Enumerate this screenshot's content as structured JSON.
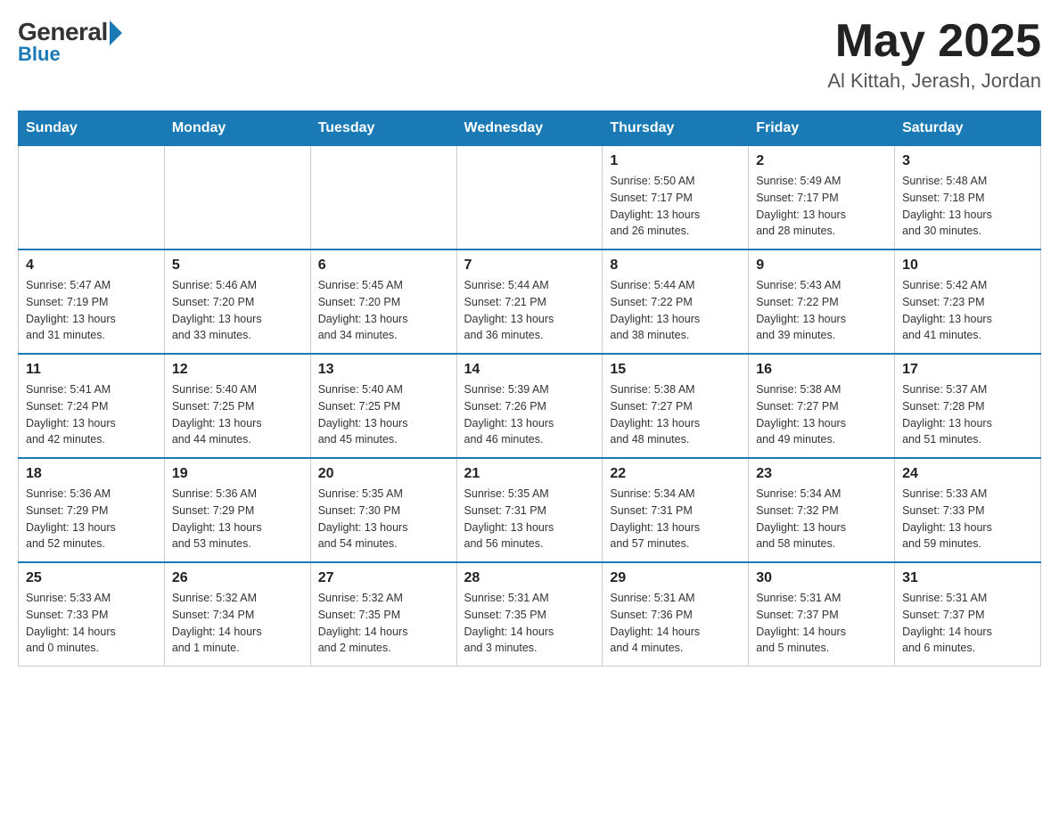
{
  "header": {
    "logo_general": "General",
    "logo_blue": "Blue",
    "month_year": "May 2025",
    "location": "Al Kittah, Jerash, Jordan"
  },
  "weekdays": [
    "Sunday",
    "Monday",
    "Tuesday",
    "Wednesday",
    "Thursday",
    "Friday",
    "Saturday"
  ],
  "weeks": [
    [
      {
        "day": "",
        "info": ""
      },
      {
        "day": "",
        "info": ""
      },
      {
        "day": "",
        "info": ""
      },
      {
        "day": "",
        "info": ""
      },
      {
        "day": "1",
        "info": "Sunrise: 5:50 AM\nSunset: 7:17 PM\nDaylight: 13 hours\nand 26 minutes."
      },
      {
        "day": "2",
        "info": "Sunrise: 5:49 AM\nSunset: 7:17 PM\nDaylight: 13 hours\nand 28 minutes."
      },
      {
        "day": "3",
        "info": "Sunrise: 5:48 AM\nSunset: 7:18 PM\nDaylight: 13 hours\nand 30 minutes."
      }
    ],
    [
      {
        "day": "4",
        "info": "Sunrise: 5:47 AM\nSunset: 7:19 PM\nDaylight: 13 hours\nand 31 minutes."
      },
      {
        "day": "5",
        "info": "Sunrise: 5:46 AM\nSunset: 7:20 PM\nDaylight: 13 hours\nand 33 minutes."
      },
      {
        "day": "6",
        "info": "Sunrise: 5:45 AM\nSunset: 7:20 PM\nDaylight: 13 hours\nand 34 minutes."
      },
      {
        "day": "7",
        "info": "Sunrise: 5:44 AM\nSunset: 7:21 PM\nDaylight: 13 hours\nand 36 minutes."
      },
      {
        "day": "8",
        "info": "Sunrise: 5:44 AM\nSunset: 7:22 PM\nDaylight: 13 hours\nand 38 minutes."
      },
      {
        "day": "9",
        "info": "Sunrise: 5:43 AM\nSunset: 7:22 PM\nDaylight: 13 hours\nand 39 minutes."
      },
      {
        "day": "10",
        "info": "Sunrise: 5:42 AM\nSunset: 7:23 PM\nDaylight: 13 hours\nand 41 minutes."
      }
    ],
    [
      {
        "day": "11",
        "info": "Sunrise: 5:41 AM\nSunset: 7:24 PM\nDaylight: 13 hours\nand 42 minutes."
      },
      {
        "day": "12",
        "info": "Sunrise: 5:40 AM\nSunset: 7:25 PM\nDaylight: 13 hours\nand 44 minutes."
      },
      {
        "day": "13",
        "info": "Sunrise: 5:40 AM\nSunset: 7:25 PM\nDaylight: 13 hours\nand 45 minutes."
      },
      {
        "day": "14",
        "info": "Sunrise: 5:39 AM\nSunset: 7:26 PM\nDaylight: 13 hours\nand 46 minutes."
      },
      {
        "day": "15",
        "info": "Sunrise: 5:38 AM\nSunset: 7:27 PM\nDaylight: 13 hours\nand 48 minutes."
      },
      {
        "day": "16",
        "info": "Sunrise: 5:38 AM\nSunset: 7:27 PM\nDaylight: 13 hours\nand 49 minutes."
      },
      {
        "day": "17",
        "info": "Sunrise: 5:37 AM\nSunset: 7:28 PM\nDaylight: 13 hours\nand 51 minutes."
      }
    ],
    [
      {
        "day": "18",
        "info": "Sunrise: 5:36 AM\nSunset: 7:29 PM\nDaylight: 13 hours\nand 52 minutes."
      },
      {
        "day": "19",
        "info": "Sunrise: 5:36 AM\nSunset: 7:29 PM\nDaylight: 13 hours\nand 53 minutes."
      },
      {
        "day": "20",
        "info": "Sunrise: 5:35 AM\nSunset: 7:30 PM\nDaylight: 13 hours\nand 54 minutes."
      },
      {
        "day": "21",
        "info": "Sunrise: 5:35 AM\nSunset: 7:31 PM\nDaylight: 13 hours\nand 56 minutes."
      },
      {
        "day": "22",
        "info": "Sunrise: 5:34 AM\nSunset: 7:31 PM\nDaylight: 13 hours\nand 57 minutes."
      },
      {
        "day": "23",
        "info": "Sunrise: 5:34 AM\nSunset: 7:32 PM\nDaylight: 13 hours\nand 58 minutes."
      },
      {
        "day": "24",
        "info": "Sunrise: 5:33 AM\nSunset: 7:33 PM\nDaylight: 13 hours\nand 59 minutes."
      }
    ],
    [
      {
        "day": "25",
        "info": "Sunrise: 5:33 AM\nSunset: 7:33 PM\nDaylight: 14 hours\nand 0 minutes."
      },
      {
        "day": "26",
        "info": "Sunrise: 5:32 AM\nSunset: 7:34 PM\nDaylight: 14 hours\nand 1 minute."
      },
      {
        "day": "27",
        "info": "Sunrise: 5:32 AM\nSunset: 7:35 PM\nDaylight: 14 hours\nand 2 minutes."
      },
      {
        "day": "28",
        "info": "Sunrise: 5:31 AM\nSunset: 7:35 PM\nDaylight: 14 hours\nand 3 minutes."
      },
      {
        "day": "29",
        "info": "Sunrise: 5:31 AM\nSunset: 7:36 PM\nDaylight: 14 hours\nand 4 minutes."
      },
      {
        "day": "30",
        "info": "Sunrise: 5:31 AM\nSunset: 7:37 PM\nDaylight: 14 hours\nand 5 minutes."
      },
      {
        "day": "31",
        "info": "Sunrise: 5:31 AM\nSunset: 7:37 PM\nDaylight: 14 hours\nand 6 minutes."
      }
    ]
  ]
}
